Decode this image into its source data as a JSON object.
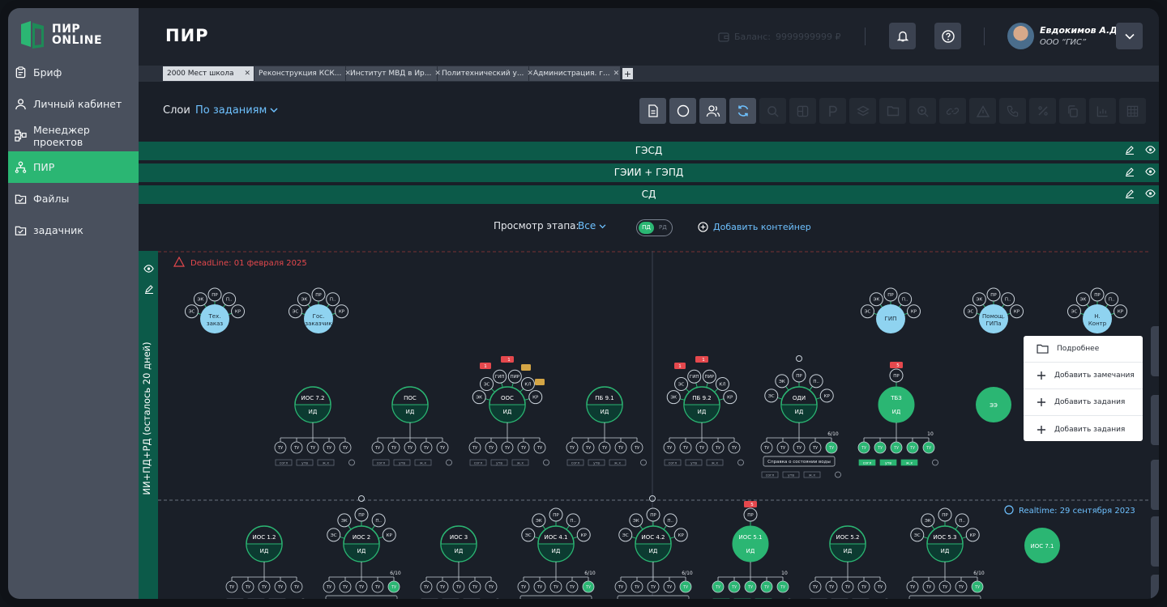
{
  "app": {
    "logo_line1": "ПИР",
    "logo_line2": "ONLINE",
    "page_title": "ПИР"
  },
  "sidebar": {
    "items": [
      {
        "label": "Бриф",
        "icon": "clipboard-icon"
      },
      {
        "label": "Личный кабинет",
        "icon": "user-icon"
      },
      {
        "label": "Менеджер проектов",
        "icon": "flowchart-icon"
      },
      {
        "label": "ПИР",
        "icon": "org-icon",
        "active": true
      },
      {
        "label": "Файлы",
        "icon": "folder-check-icon"
      },
      {
        "label": "задачник",
        "icon": "task-icon"
      }
    ]
  },
  "header": {
    "balance_label": "Баланс:",
    "balance_value": "9999999999 ₽",
    "user_name": "Евдокимов А.Д.",
    "user_org": "ООО “ГИС”"
  },
  "tabs": [
    "2000 Мест школа",
    "Реконструкция КСК...",
    "Институт МВД в Ир...",
    "Политехнический у...",
    "Администрация. г..."
  ],
  "toolbar": {
    "layers_label": "Слои",
    "layers_value": "По заданиям"
  },
  "bands": [
    "ГЭСД",
    "ГЭИИ + ГЭПД",
    "СД"
  ],
  "stage": {
    "label": "Просмотр этапа:",
    "value": "Все",
    "toggle_on": "ПД",
    "toggle_off": "РД",
    "add_container": "Добавить контейнер"
  },
  "board": {
    "vertical_label": "ИИ+ПД+РД (осталось 20 дней)",
    "deadline": "DeadLine: 01 февраля 2025",
    "realtime": "Realtime: 29 сентября 2023",
    "petals": [
      "ЭС",
      "ЭК",
      "ПР",
      "П..",
      "КР"
    ],
    "petals_gip": [
      "ЭК",
      "ЭС",
      "ГИП",
      "ПИР",
      "КЛ",
      "КР"
    ],
    "id": "ИД",
    "tu": "ТУ",
    "pr": "ПР",
    "status_tags": [
      "согл",
      "утв",
      "ж.х"
    ],
    "water_note": "Справка о состоянии воды",
    "count_6_10": "6/10",
    "count_10": "10",
    "alert_1": "1",
    "alert_5": "5",
    "top_nodes": [
      "Тех. заказ",
      "Гос. заказчик",
      "ГИП",
      "Помощ. ГИПа",
      "Н. Контр"
    ],
    "row1": [
      "ИОС 7.2",
      "ПОС",
      "ООС",
      "ПБ 9.1",
      "ПБ 9.2",
      "ОДИ",
      "ТБЗ",
      "ЭЭ"
    ],
    "row2": [
      "ИОС 1.2",
      "ИОС 2",
      "ИОС 3",
      "ИОС 4.1",
      "ИОС 4.2",
      "ИОС 5.1",
      "ИОС 5.2",
      "ИОС 5.3",
      "ИОС 7.1"
    ]
  },
  "context_menu": [
    "Подробнее",
    "Добавить замечания",
    "Добавить задания",
    "Добавить задания"
  ],
  "colors": {
    "accent": "#2bb673",
    "band": "#0c5a49",
    "link": "#6ec1ff",
    "danger": "#e5484d",
    "node_light": "#8fd3f0"
  }
}
